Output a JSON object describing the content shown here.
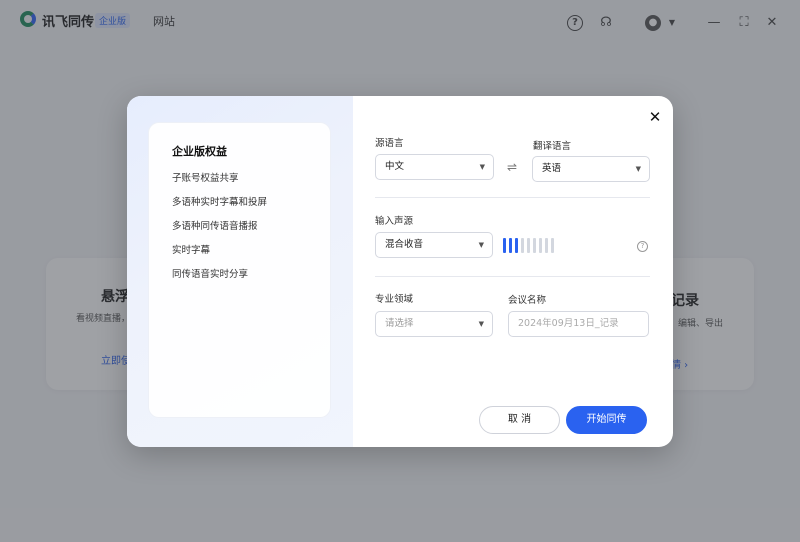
{
  "app": {
    "brand": "讯飞同传",
    "edition_badge": "企业版",
    "nav_site": "网站",
    "icons": [
      "help-icon",
      "headset-icon",
      "avatar",
      "chevron-down-icon",
      "minimize-icon",
      "maximize-icon",
      "close-icon"
    ]
  },
  "background_cards": {
    "left": {
      "title": "悬浮",
      "desc": "看视频直播，",
      "link": "立即使"
    },
    "right": {
      "title": "记录",
      "desc": "、编辑、导出",
      "link": "情 ›"
    }
  },
  "modal": {
    "benefits": {
      "title": "企业版权益",
      "items": [
        "子账号权益共享",
        "多语种实时字幕和投屏",
        "多语种同传语音播报",
        "实时字幕",
        "同传语音实时分享"
      ]
    },
    "source_language": {
      "label": "源语言",
      "value": "中文"
    },
    "target_language": {
      "label": "翻译语言",
      "value": "英语"
    },
    "audio_source": {
      "label": "输入声源",
      "value": "混合收音",
      "level_bars_total": 9,
      "level_bars_active": 3
    },
    "domain": {
      "label": "专业领域",
      "placeholder": "请选择"
    },
    "meeting_name": {
      "label": "会议名称",
      "placeholder": "2024年09月13日_记录"
    },
    "cancel_label": "取 消",
    "start_label": "开始同传",
    "accent_color": "#2a62f0"
  }
}
